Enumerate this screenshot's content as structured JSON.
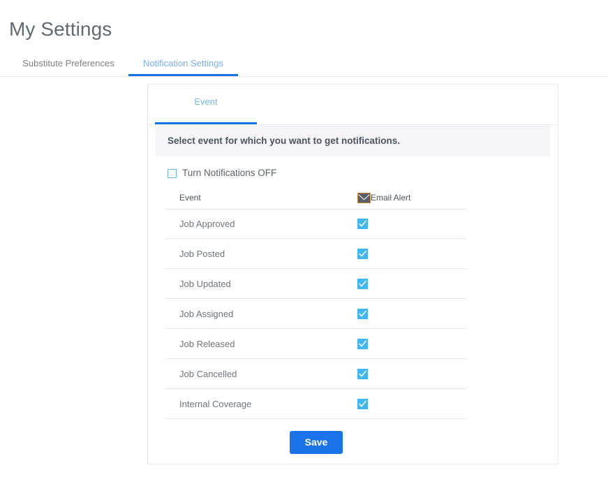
{
  "page": {
    "title": "My Settings"
  },
  "top_tabs": [
    {
      "label": "Substitute Preferences",
      "active": false
    },
    {
      "label": "Notification Settings",
      "active": true
    }
  ],
  "card": {
    "tab": {
      "label": "Event",
      "active": true
    },
    "banner": {
      "text": "Select event for which you want to get notifications."
    },
    "turn_off": {
      "label": "Turn Notifications OFF",
      "checked": false,
      "icon": "checkbox-unchecked-icon"
    },
    "table": {
      "columns": [
        {
          "key": "event",
          "label": "Event"
        },
        {
          "key": "email_alert",
          "label": "Email Alert",
          "icon": "envelope-icon"
        }
      ],
      "rows": [
        {
          "event": "Job Approved",
          "email_alert": true
        },
        {
          "event": "Job Posted",
          "email_alert": true
        },
        {
          "event": "Job Updated",
          "email_alert": true
        },
        {
          "event": "Job Assigned",
          "email_alert": true
        },
        {
          "event": "Job Released",
          "email_alert": true
        },
        {
          "event": "Job Cancelled",
          "email_alert": true
        },
        {
          "event": "Internal Coverage",
          "email_alert": true
        }
      ]
    },
    "save": {
      "label": "Save"
    }
  },
  "colors": {
    "accent_blue": "#1673e6",
    "tab_text_blue": "#79aef4",
    "checkbox_blue": "#41b6f5",
    "save_button_blue": "#1a73e8",
    "banner_bg": "#f5f5f9",
    "title_gray": "#5f6b72",
    "body_text_gray": "#6c757d",
    "divider_gray": "#e7e8ea"
  }
}
